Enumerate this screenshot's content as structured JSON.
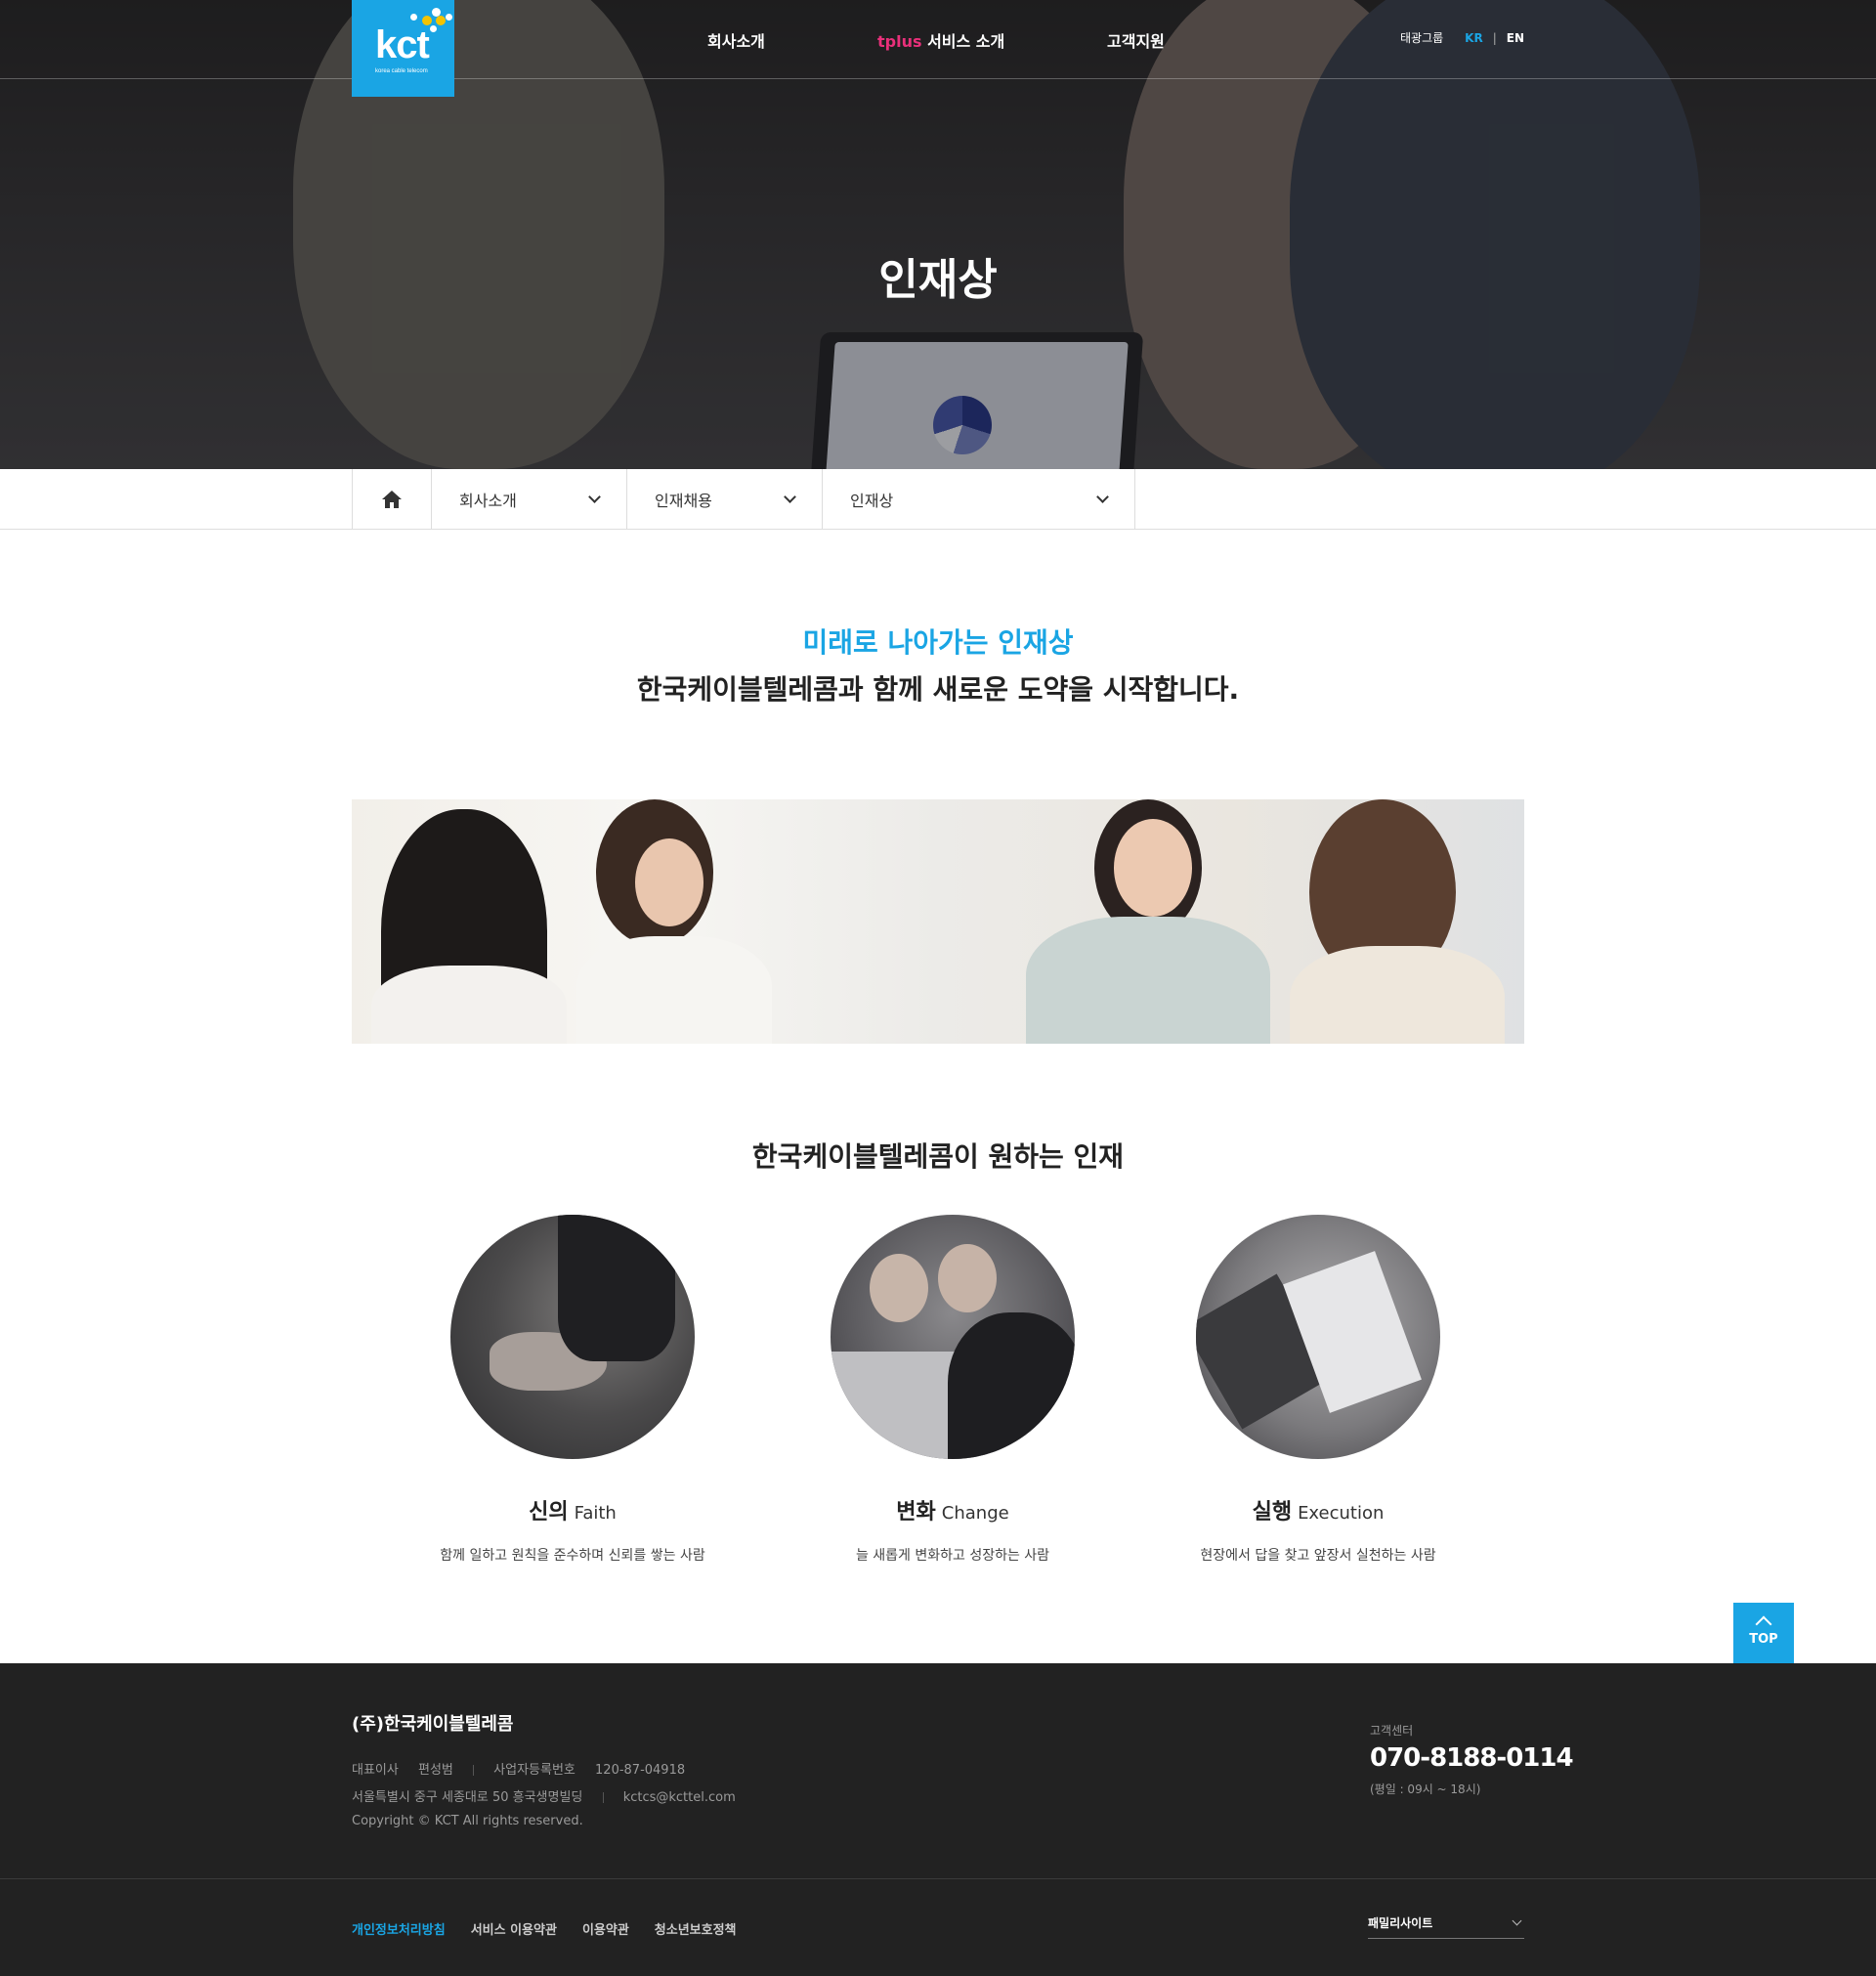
{
  "header": {
    "logo_text": "kct",
    "logo_subtitle": "korea cable telecom",
    "nav": [
      {
        "label": "회사소개"
      },
      {
        "prefix": "tplus",
        "label": "서비스 소개"
      },
      {
        "label": "고객지원"
      }
    ],
    "util": {
      "group": "태광그룹",
      "kr": "KR",
      "sep": "|",
      "en": "EN"
    }
  },
  "hero": {
    "title": "인재상"
  },
  "location": {
    "items": [
      {
        "label": "회사소개"
      },
      {
        "label": "인재채용"
      },
      {
        "label": "인재상"
      }
    ]
  },
  "intro": {
    "headline": "미래로 나아가는 인재상",
    "subline": "한국케이블텔레콤과 함께 새로운 도약을 시작합니다."
  },
  "ideal": {
    "title": "한국케이블텔레콤이 원하는 인재",
    "cards": [
      {
        "name_ko": "신의",
        "name_en": "Faith",
        "desc": "함께 일하고 원칙을 준수하며 신뢰를 쌓는 사람"
      },
      {
        "name_ko": "변화",
        "name_en": "Change",
        "desc": "늘 새롭게 변화하고 성장하는 사람"
      },
      {
        "name_ko": "실행",
        "name_en": "Execution",
        "desc": "현장에서 답을 찾고 앞장서 실천하는 사람"
      }
    ]
  },
  "top_button": {
    "label": "TOP"
  },
  "footer": {
    "company": "(주)한국케이블텔레콤",
    "ceo_label": "대표이사",
    "ceo_name": "편성범",
    "biz_label": "사업자등록번호",
    "biz_no": "120-87-04918",
    "address": "서울특별시 중구 세종대로 50 흥국생명빌딩",
    "email": "kctcs@kcttel.com",
    "copyright": "Copyright © KCT All rights reserved.",
    "cs_label": "고객센터",
    "cs_phone": "070-8188-0114",
    "cs_hours": "(평일 : 09시 ~ 18시)",
    "links": [
      {
        "label": "개인정보처리방침"
      },
      {
        "label": "서비스 이용약관"
      },
      {
        "label": "이용약관"
      },
      {
        "label": "청소년보호정책"
      }
    ],
    "family_site": "패밀리사이트"
  },
  "colors": {
    "accent": "#1aa5e4",
    "tplus": "#e8307a",
    "footer_bg": "#222222"
  }
}
